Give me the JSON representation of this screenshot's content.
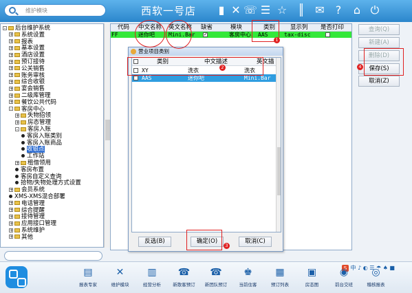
{
  "topbar": {
    "search_placeholder": "维护模块",
    "shop_name": "西软一号店",
    "icons": [
      "signal-icon",
      "tools-icon",
      "phone-icon",
      "menu-icon",
      "star-icon",
      "columns-icon",
      "mail-icon",
      "help-icon",
      "home-icon",
      "power-icon"
    ]
  },
  "tree": {
    "items": [
      {
        "label": "后台维护系统",
        "level": 0,
        "kind": "root",
        "toggle": "-"
      },
      {
        "label": "系统设置",
        "level": 1,
        "kind": "folder",
        "toggle": "+"
      },
      {
        "label": "报表",
        "level": 1,
        "kind": "folder",
        "toggle": "+"
      },
      {
        "label": "基本设置",
        "level": 1,
        "kind": "folder",
        "toggle": "+"
      },
      {
        "label": "酒店设置",
        "level": 1,
        "kind": "folder",
        "toggle": "+"
      },
      {
        "label": "预订接待",
        "level": 1,
        "kind": "folder",
        "toggle": "+"
      },
      {
        "label": "公关销售",
        "level": 1,
        "kind": "folder",
        "toggle": "+"
      },
      {
        "label": "账务审核",
        "level": 1,
        "kind": "folder",
        "toggle": "+"
      },
      {
        "label": "综合收银",
        "level": 1,
        "kind": "folder",
        "toggle": "+"
      },
      {
        "label": "宴会销售",
        "level": 1,
        "kind": "folder",
        "toggle": "+"
      },
      {
        "label": "二级库管理",
        "level": 1,
        "kind": "folder",
        "toggle": "+"
      },
      {
        "label": "餐饮公共代码",
        "level": 1,
        "kind": "folder",
        "toggle": "+"
      },
      {
        "label": "客房中心",
        "level": 1,
        "kind": "folder",
        "toggle": "-"
      },
      {
        "label": "失物招领",
        "level": 2,
        "kind": "folder",
        "toggle": "+"
      },
      {
        "label": "房态管理",
        "level": 2,
        "kind": "folder",
        "toggle": "+"
      },
      {
        "label": "客房入账",
        "level": 2,
        "kind": "folder",
        "toggle": "-"
      },
      {
        "label": "客房入账类别",
        "level": 3,
        "kind": "leaf"
      },
      {
        "label": "客房入账商品",
        "level": 3,
        "kind": "leaf"
      },
      {
        "label": "收银点",
        "level": 3,
        "kind": "leaf",
        "selected": true
      },
      {
        "label": "工作站",
        "level": 3,
        "kind": "leaf"
      },
      {
        "label": "租借领用",
        "level": 2,
        "kind": "folder",
        "toggle": "+"
      },
      {
        "label": "客房布置",
        "level": 2,
        "kind": "leaf"
      },
      {
        "label": "客房自定义查询",
        "level": 2,
        "kind": "leaf"
      },
      {
        "label": "拾物/失物处理方式设置",
        "level": 2,
        "kind": "leaf"
      },
      {
        "label": "会员系统",
        "level": 1,
        "kind": "folder",
        "toggle": "+"
      },
      {
        "label": "XMS-XMS混合部署",
        "level": 1,
        "kind": "leaf"
      },
      {
        "label": "电话管理",
        "level": 1,
        "kind": "folder",
        "toggle": "+"
      },
      {
        "label": "综合提醒",
        "level": 1,
        "kind": "folder",
        "toggle": "+"
      },
      {
        "label": "接待管理",
        "level": 1,
        "kind": "folder",
        "toggle": "+"
      },
      {
        "label": "应用接口管理",
        "level": 1,
        "kind": "folder",
        "toggle": "+"
      },
      {
        "label": "系统维护",
        "level": 1,
        "kind": "folder",
        "toggle": "+"
      },
      {
        "label": "其他",
        "level": 1,
        "kind": "folder",
        "toggle": "+"
      }
    ]
  },
  "grid": {
    "headers": [
      "代码",
      "中文名称",
      "英文名称",
      "缺省",
      "模块",
      "类别",
      "显示列",
      "是否打印"
    ],
    "row": {
      "code": "FF",
      "cn_name": "迷你吧",
      "en_name": "Mini.Bar",
      "default_checked": true,
      "module": "客房中心",
      "category": "AAS",
      "display_col": "tax-disc",
      "print_checked": false
    }
  },
  "right_buttons": [
    {
      "label": "查询(Q)",
      "enabled": false
    },
    {
      "label": "新建(A)",
      "enabled": false
    },
    {
      "label": "删除(D)",
      "enabled": false
    },
    {
      "label": "保存(S)",
      "enabled": true
    },
    {
      "label": "取消(Z)",
      "enabled": true
    }
  ],
  "dialog": {
    "title": "营业项目类别",
    "headers": [
      "类别",
      "中文描述",
      "英文描"
    ],
    "rows": [
      {
        "checked": false,
        "cat": "XY",
        "cn": "洗衣",
        "en": "洗衣",
        "selected": false
      },
      {
        "checked": true,
        "cat": "AAS",
        "cn": "迷你吧",
        "en": "Mini.Bar",
        "selected": true
      }
    ],
    "buttons": {
      "invert": "反选(B)",
      "ok": "确定(O)",
      "cancel": "取消(C)"
    }
  },
  "annotations": [
    "1",
    "2",
    "3",
    "4"
  ],
  "bottombar": {
    "items": [
      {
        "label": "报表专家",
        "icon": "report-expert-icon",
        "glyph": "▤"
      },
      {
        "label": "维护模块",
        "icon": "maintenance-icon",
        "glyph": "✕"
      },
      {
        "label": "经营分析",
        "icon": "analysis-icon",
        "glyph": "▥"
      },
      {
        "label": "新散客预订",
        "icon": "new-guest-booking-icon",
        "glyph": "☎"
      },
      {
        "label": "新团队预订",
        "icon": "new-team-booking-icon",
        "glyph": "☎"
      },
      {
        "label": "当前住客",
        "icon": "current-guest-icon",
        "glyph": "♚"
      },
      {
        "label": "预订列表",
        "icon": "booking-list-icon",
        "glyph": "▦"
      },
      {
        "label": "房态图",
        "icon": "room-status-icon",
        "glyph": "▣"
      },
      {
        "label": "前台交班",
        "icon": "front-desk-shift-icon",
        "glyph": "◉"
      },
      {
        "label": "稽核报表",
        "icon": "audit-report-icon",
        "glyph": "◎"
      }
    ],
    "tray_text": "中 ♪ ◐ ☰ ☂ ♠ ■"
  }
}
